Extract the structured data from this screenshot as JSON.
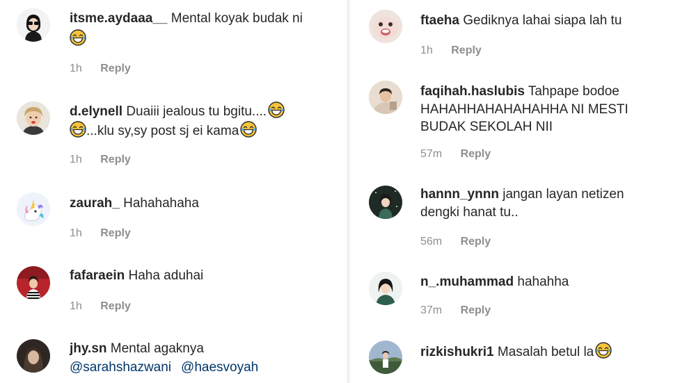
{
  "left_column": [
    {
      "username": "itsme.aydaaa__",
      "line1": "Mental koyak budak ni",
      "line2": "",
      "time": "1h",
      "reply_label": "Reply"
    },
    {
      "username": "d.elynell",
      "line1": "Duaiii jealous tu bgitu....",
      "line2": "...klu sy,sy post sj ei kama",
      "time": "1h",
      "reply_label": "Reply"
    },
    {
      "username": "zaurah_",
      "line1": "Hahahahaha",
      "time": "1h",
      "reply_label": "Reply"
    },
    {
      "username": "fafaraein",
      "line1": "Haha aduhai",
      "time": "1h",
      "reply_label": "Reply"
    },
    {
      "username": "jhy.sn",
      "line1": "Mental agaknya",
      "mentions": [
        "@sarahshazwani",
        "@haesvoyah"
      ]
    }
  ],
  "right_column": [
    {
      "username": "ftaeha",
      "line1": "Gediknya lahai siapa lah tu",
      "time": "1h",
      "reply_label": "Reply"
    },
    {
      "username": "faqihah.haslubis",
      "line1": "Tahpape bodoe",
      "line2": "HAHAHHAHAHAHAHHA NI MESTI",
      "line3": "BUDAK SEKOLAH NII",
      "time": "57m",
      "reply_label": "Reply"
    },
    {
      "username": "hannn_ynnn",
      "line1": "jangan layan netizen",
      "line2": "dengki hanat tu..",
      "time": "56m",
      "reply_label": "Reply"
    },
    {
      "username": "n_.muhammad",
      "line1": "hahahha",
      "time": "37m",
      "reply_label": "Reply"
    },
    {
      "username": "rizkishukri1",
      "line1": "Masalah betul la"
    }
  ],
  "icons": {
    "emoji": "face-with-tears-of-joy-icon"
  },
  "colors": {
    "text": "#262626",
    "meta": "#8e8e8e",
    "mention": "#00376b",
    "divider": "#f2f2f2"
  }
}
